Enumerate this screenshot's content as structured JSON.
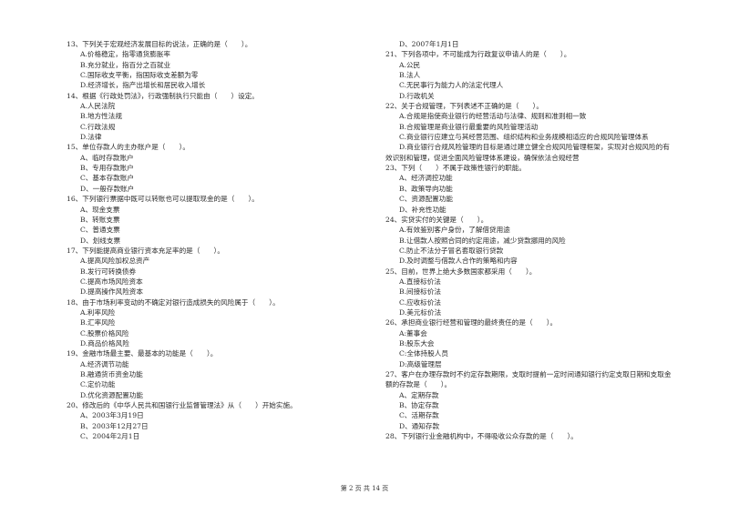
{
  "left_column": [
    {
      "stem": "13、下列关于宏观经济发展目标的说法，正确的是（　　）。",
      "options": [
        "A.价格稳定，指零通货膨胀率",
        "B.充分就业，指百分之百就业",
        "C.国际收支平衡，指国际收支差额为零",
        "D.经济增长，指产出增长和居民收入增长"
      ]
    },
    {
      "stem": "14、根据《行政处罚法》，行政强制执行只能由（　　）设定。",
      "options": [
        "A.人民法院",
        "B.地方性法规",
        "C.行政法规",
        "D.法律"
      ]
    },
    {
      "stem": "15、单位存款人的主办账户是（　　）。",
      "options": [
        "A、临时存款账户",
        "B、专用存款账户",
        "C、基本存款账户",
        "D、一般存款账户"
      ]
    },
    {
      "stem": "16、下列银行票据中既可以转账也可以提取现金的是（　　）。",
      "options": [
        "A、现金支票",
        "B、转账支票",
        "C、普通支票",
        "D、划线支票"
      ]
    },
    {
      "stem": "17、下列能提高商业银行资本充足率的是（　　）。",
      "options": [
        "A.提高风险加权总资产",
        "B.发行可转换债券",
        "C.提高市场风险资本",
        "D.提高操作风险资本"
      ]
    },
    {
      "stem": "18、由于市场利率变动的不确定对银行造成损失的风险属于（　　）。",
      "options": [
        "A.利率风险",
        "B.汇率风险",
        "C.股票价格风险",
        "D.商品价格风险"
      ]
    },
    {
      "stem": "19、金融市场最主要、最基本的功能是（　　）。",
      "options": [
        "A.经济调节功能",
        "B.融通货币资金功能",
        "C.定价功能",
        "D.优化资源配置功能"
      ]
    },
    {
      "stem": "20、修改后的《中华人民共和国银行业监督管理法》从（　　）开始实施。",
      "options": [
        "A、2003年3月19日",
        "B、2003年12月27日",
        "C、2004年2月1日"
      ]
    }
  ],
  "right_column_top_option": "D、2007年1月1日",
  "right_column": [
    {
      "stem": "21、下列各项中，不可能成为行政复议申请人的是（　　）。",
      "options": [
        "A.公民",
        "B.法人",
        "C.无民事行为能力人的法定代理人",
        "D.行政机关"
      ]
    },
    {
      "stem": "22、关于合规管理，下列表述不正确的是（　　）。",
      "options": [
        "A.合规是指使商业银行的经营活动与法律、规则和准则相一致",
        "B.合规管理是商业银行最重要的风险管理活动",
        "C.商业银行应建立与其经营范围、组织结构和业务规模相适应的合规风险管理体系",
        "D.商业银行合规风险管理的目标是通过建立健全合规风险管理框架，实现对合规风险的有"
      ],
      "continuation": "效识别和管理，促进全面风险管理体系建设，确保依法合规经营"
    },
    {
      "stem": "23、下列（　　）不属于政策性银行的职能。",
      "options": [
        "A、经济调控功能",
        "B、政策导向功能",
        "C、资源配置功能",
        "D、补充性功能"
      ]
    },
    {
      "stem": "24、实贷实付的关键是（　　）。",
      "options": [
        "A.有效鉴别客户身份，了解借贷用途",
        "B.让借款人按照合同的约定用途，减少贷款挪用的风险",
        "C.防止不法分子冒名套取银行贷款",
        "D.及时调整与借款人合作的策略和内容"
      ]
    },
    {
      "stem": "25、目前，世界上绝大多数国家都采用（　　）。",
      "options": [
        "A.直接标价法",
        "B.间接标价法",
        "C.应收标价法",
        "D.美元标价法"
      ]
    },
    {
      "stem": "26、承担商业银行经营和管理的最终责任的是（　　）。",
      "options": [
        "A:董事会",
        "B:股东大会",
        "C:全体持股人员",
        "D:高级管理层"
      ]
    },
    {
      "stem": "27、客户在办理存款时不约定存款期限，支取时提前一定时间通知银行约定支取日期和支取金",
      "stem_continuation": "额的存款是（　　）。",
      "options": [
        "A、定期存款",
        "B、协定存款",
        "C、活期存款",
        "D、通知存款"
      ]
    },
    {
      "stem": "28、下列银行业金融机构中，不得吸收公众存款的是（　　）。",
      "options": []
    }
  ],
  "footer": {
    "page_label": "第 2 页 共 14 页"
  }
}
